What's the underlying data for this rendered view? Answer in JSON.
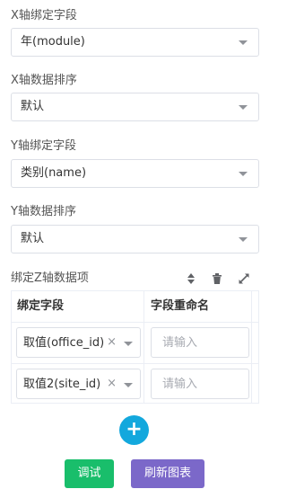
{
  "x_axis_field": {
    "label": "X轴绑定字段",
    "value": "年(module)"
  },
  "x_axis_sort": {
    "label": "X轴数据排序",
    "value": "默认"
  },
  "y_axis_field": {
    "label": "Y轴绑定字段",
    "value": "类别(name)"
  },
  "y_axis_sort": {
    "label": "Y轴数据排序",
    "value": "默认"
  },
  "z_axis_section": {
    "label": "绑定Z轴数据项",
    "icons": [
      "sort-icon",
      "trash-icon",
      "expand-icon"
    ],
    "table": {
      "headers": [
        "绑定字段",
        "字段重命名"
      ],
      "rows": [
        {
          "field": "取值(office_id)",
          "clear": "×",
          "rename_placeholder": "请输入"
        },
        {
          "field": "取值2(site_id)",
          "clear": "×",
          "rename_placeholder": "请输入"
        }
      ]
    },
    "add_label": "+"
  },
  "buttons": {
    "debug": "调试",
    "refresh": "刷新图表"
  },
  "colors": {
    "add": "#13a8dd",
    "debug": "#19be6b",
    "refresh": "#7b68c9"
  }
}
